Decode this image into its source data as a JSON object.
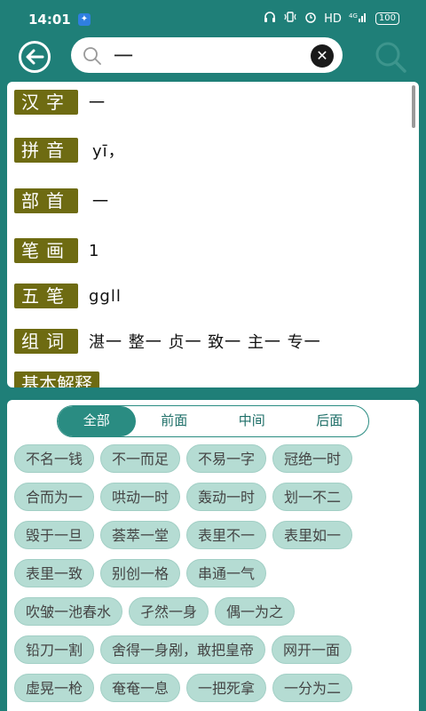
{
  "status": {
    "time": "14:01",
    "badge": "✦",
    "hd": "HD",
    "signal": "4G",
    "battery": "100"
  },
  "search": {
    "query": "一"
  },
  "detail": {
    "rows": [
      {
        "label": "汉字",
        "value": "一"
      },
      {
        "label": "拼音",
        "value": "yī，"
      },
      {
        "label": "部首",
        "value": "一"
      },
      {
        "label": "笔画",
        "value": "1"
      },
      {
        "label": "五笔",
        "value": "ggll"
      },
      {
        "label": "组词",
        "value": "湛一 整一 贞一 致一 主一 专一"
      },
      {
        "label": "基本解释",
        "value": ""
      }
    ]
  },
  "tabs": [
    "全部",
    "前面",
    "中间",
    "后面"
  ],
  "active_tab": "全部",
  "idioms": [
    [
      "不名一钱",
      "不一而足",
      "不易一字",
      "冠绝一时"
    ],
    [
      "合而为一",
      "哄动一时",
      "轰动一时",
      "划一不二"
    ],
    [
      "毁于一旦",
      "荟萃一堂",
      "表里不一",
      "表里如一"
    ],
    [
      "表里一致",
      "别创一格",
      "串通一气"
    ],
    [
      "吹皱一池春水",
      "孑然一身",
      "偶一为之"
    ],
    [
      "铅刀一割",
      "舍得一身剐，敢把皇帝",
      "网开一面"
    ],
    [
      "虚晃一枪",
      "奄奄一息",
      "一把死拿",
      "一分为二"
    ]
  ]
}
